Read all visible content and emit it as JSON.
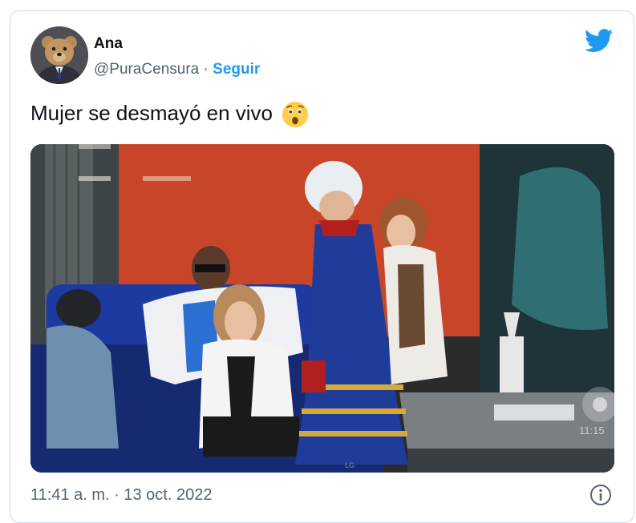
{
  "tweet": {
    "author_name": "Ana",
    "handle": "@PuraCensura",
    "separator": "·",
    "follow_label": "Seguir",
    "text": "Mujer se desmayó en vivo",
    "emoji": "astonished-face-icon",
    "timestamp": "11:41 a. m. · 13 oct. 2022",
    "media": {
      "description_icon": "video-still-image",
      "overlay_time": "11:15",
      "tv_brand": "LG"
    }
  },
  "icons": {
    "brand": "twitter-bird-icon",
    "info": "info-icon"
  },
  "colors": {
    "accent": "#1d9bf0",
    "text_primary": "#0f1419",
    "text_secondary": "#536471"
  }
}
